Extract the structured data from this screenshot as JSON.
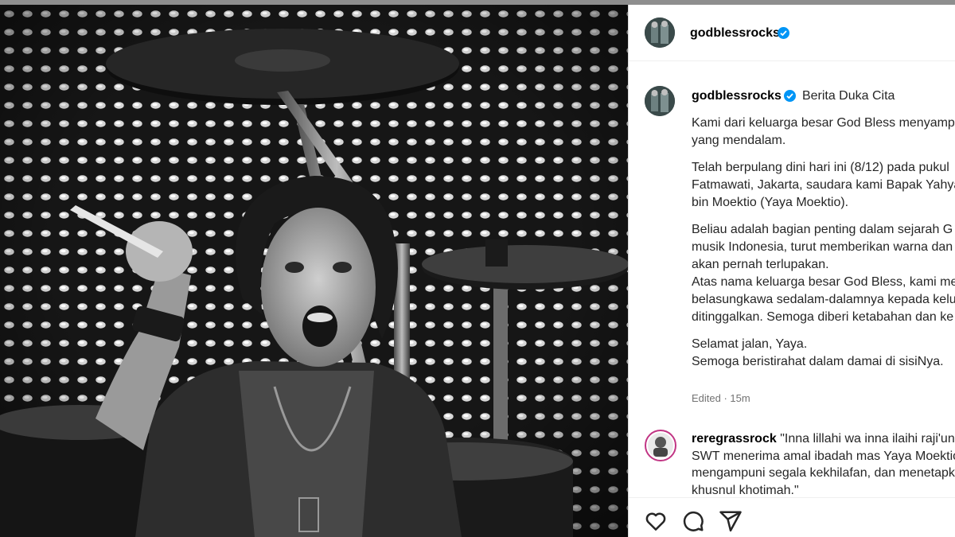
{
  "post": {
    "author": "godblessrocks",
    "verified": true,
    "photo_alt": "Black and white photo of a drummer"
  },
  "caption": {
    "author": "godblessrocks",
    "headline": "Berita Duka Cita",
    "lines": [
      "Kami dari keluarga besar God Bless menyampa",
      "yang mendalam.",
      "",
      "Telah berpulang dini hari ini (8/12) pada pukul",
      "Fatmawati, Jakarta, saudara kami Bapak Yahya",
      "bin Moektio (Yaya Moektio).",
      "",
      "Beliau adalah bagian penting dalam sejarah G",
      "musik Indonesia, turut memberikan warna dan",
      "akan pernah terlupakan.",
      "Atas nama keluarga besar God Bless, kami me",
      "belasungkawa sedalam-dalamnya kepada kelu",
      "ditinggalkan. Semoga diberi ketabahan dan ke",
      "",
      "Selamat jalan, Yaya.",
      "Semoga beristirahat dalam damai di sisiNya."
    ],
    "meta": "Edited · 15m"
  },
  "comment": {
    "author": "reregrassrock",
    "first_line": "\"Inna lillahi wa inna ilaihi raji'un",
    "lines": [
      "SWT menerima amal ibadah mas Yaya Moektio",
      "mengampuni segala kekhilafan, dan menetapk",
      "khusnul khotimah.\""
    ]
  },
  "actions": {
    "like": "heart-icon",
    "comment": "comment-icon",
    "share": "share-icon"
  },
  "colors": {
    "verified": "#0095f6",
    "text": "#262626",
    "muted": "#737373"
  }
}
